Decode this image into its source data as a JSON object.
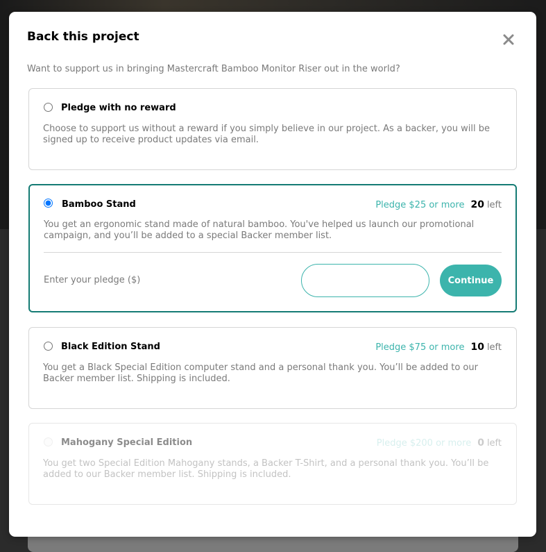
{
  "modal": {
    "title": "Back this project",
    "subtitle": "Want to support us in bringing Mastercraft Bamboo Monitor Riser out in the world?",
    "close_icon": "close-icon"
  },
  "options": [
    {
      "name": "Pledge with no reward",
      "description": "Choose to support us without a reward if you simply believe in our project. As a backer, you will be signed up to receive product updates via email.",
      "selected": false,
      "disabled": false
    },
    {
      "name": "Bamboo Stand",
      "pledge": "Pledge $25 or more",
      "count": "20",
      "left_label": "left",
      "description": "You get an ergonomic stand made of natural bamboo. You've helped us launch our promotional campaign, and you’ll be added to a special Backer member list.",
      "selected": true,
      "disabled": false,
      "pledge_input_label": "Enter your pledge ($)",
      "pledge_input_value": "",
      "continue_label": "Continue"
    },
    {
      "name": "Black Edition Stand",
      "pledge": "Pledge $75 or more",
      "count": "10",
      "left_label": "left",
      "description": "You get a Black Special Edition computer stand and a personal thank you. You’ll be added to our Backer member list. Shipping is included.",
      "selected": false,
      "disabled": false
    },
    {
      "name": "Mahogany Special Edition",
      "pledge": "Pledge $200 or more",
      "count": "0",
      "left_label": "left",
      "description": "You get two Special Edition Mahogany stands, a Backer T-Shirt, and a personal thank you. You’ll be added to our Backer member list. Shipping is included.",
      "selected": false,
      "disabled": true
    }
  ],
  "colors": {
    "accent": "#3cb4ac",
    "accent_dark": "#147b74",
    "text_muted": "#7a7a7a"
  }
}
